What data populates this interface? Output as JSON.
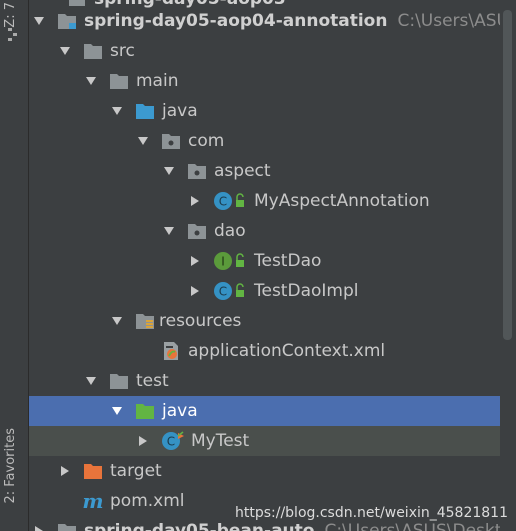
{
  "toolstrip": {
    "top_label": "Z: 7",
    "favorites_label": "2: Favorites"
  },
  "tree": {
    "top_partial": "spring-day05-aop03",
    "project": {
      "name": "spring-day05-aop04-annotation",
      "path": "C:\\Users\\ASU"
    },
    "src": "src",
    "main": "main",
    "main_java": "java",
    "com": "com",
    "aspect": "aspect",
    "my_aspect_annotation": "MyAspectAnnotation",
    "dao": "dao",
    "test_dao": "TestDao",
    "test_dao_impl": "TestDaoImpl",
    "resources": "resources",
    "application_context": "applicationContext.xml",
    "test": "test",
    "test_java": "java",
    "my_test": "MyTest",
    "target": "target",
    "pom": "pom.xml",
    "bottom_partial": {
      "name": "spring-day05-bean-auto",
      "path": "C:\\Users\\ASUS\\Deskt"
    }
  },
  "watermark": "https://blog.csdn.net/weixin_45821811",
  "colors": {
    "background": "#3c3f41",
    "selection": "#4b6eaf",
    "folder_gray": "#8d9396",
    "source_blue": "#3c9ad0",
    "test_green": "#62b543",
    "target_orange": "#e8743b",
    "class_teal": "#3592c4",
    "interface_green": "#5b9b3b"
  }
}
